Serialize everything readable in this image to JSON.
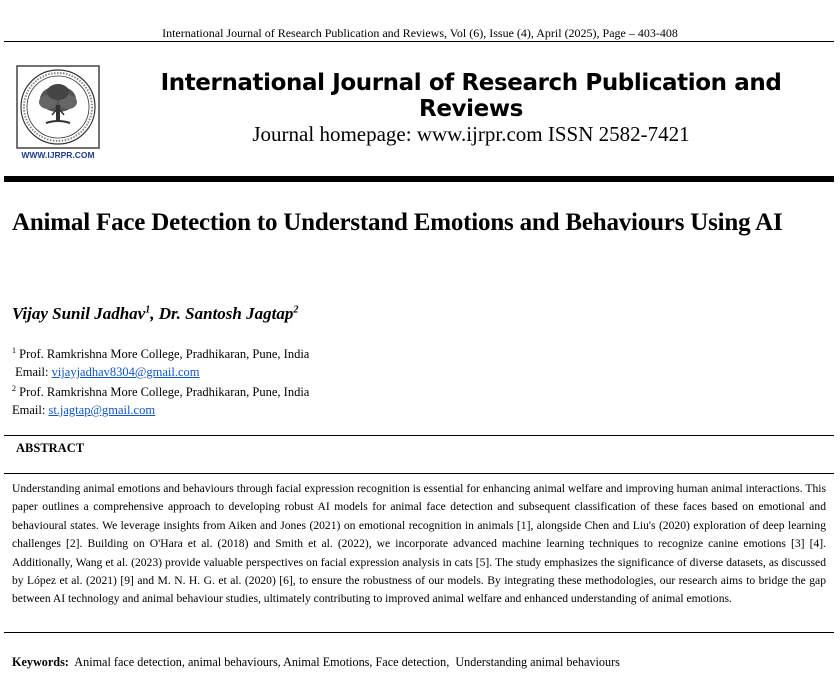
{
  "running_header": "International Journal of Research Publication and Reviews, Vol (6), Issue (4), April (2025), Page – 403-408",
  "logo": {
    "icon": "tree-seal-icon",
    "caption": "WWW.IJRPR.COM",
    "accent": "#1f3f8f"
  },
  "journal": {
    "title": "International Journal of Research Publication and Reviews",
    "homepage_line": "Journal homepage: www.ijrpr.com  ISSN 2582-7421"
  },
  "paper": {
    "title": "Animal Face Detection to Understand Emotions and Behaviours Using AI",
    "authors": [
      {
        "name": "Vijay Sunil Jadhav",
        "affiliation_mark": "1"
      },
      {
        "name": "Dr. Santosh Jagtap",
        "affiliation_mark": "2"
      }
    ],
    "author_separator": ", ",
    "affiliations": [
      {
        "mark": "1",
        "text": " Prof. Ramkrishna More College, Pradhikaran, Pune, India",
        "email_label": " Email: ",
        "email": "vijayjadhav8304@gmail.com"
      },
      {
        "mark": "2",
        "text": " Prof. Ramkrishna More College, Pradhikaran, Pune, India",
        "email_label": "Email: ",
        "email": "st.jagtap@gmail.com"
      }
    ],
    "abstract_heading": "ABSTRACT",
    "abstract": "Understanding animal emotions and behaviours through facial expression recognition is essential for enhancing animal welfare and improving human animal interactions. This paper outlines a comprehensive approach to developing robust AI models for animal face detection and subsequent classification of these faces based on emotional and behavioural states. We leverage insights from Aiken and Jones (2021) on emotional recognition in animals [1], alongside Chen and Liu's (2020) exploration of deep learning challenges [2]. Building on O'Hara et al. (2018) and Smith et al. (2022), we incorporate advanced machine learning techniques to recognize canine emotions [3] [4]. Additionally, Wang et al. (2023) provide valuable perspectives on facial expression analysis in cats [5]. The study emphasizes the significance of diverse datasets, as discussed by López et al. (2021) [9] and M. N. H. G. et al. (2020) [6], to ensure the robustness of our models. By integrating these methodologies, our research aims to bridge the gap between AI technology and animal behaviour studies, ultimately contributing to improved animal welfare and enhanced understanding of animal emotions.",
    "keywords_label": "Keywords:",
    "keywords": "  Animal face detection, animal behaviours, Animal Emotions, Face detection,  Understanding animal behaviours"
  }
}
